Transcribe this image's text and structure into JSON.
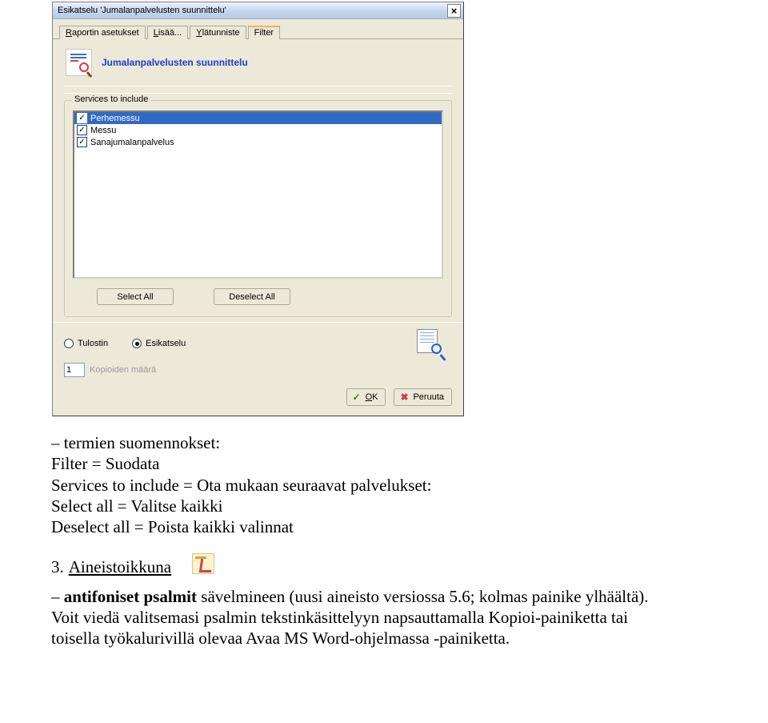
{
  "dialog": {
    "title": "Esikatselu 'Jumalanpalvelusten suunnittelu'",
    "tabs": {
      "report_settings": "Raportin asetukset",
      "add": "Lisää...",
      "header": "Ylätunniste",
      "filter": "Filter"
    },
    "content_header": "Jumalanpalvelusten suunnittelu",
    "group": {
      "legend": "Services to include",
      "items": [
        "Perhemessu",
        "Messu",
        "Sanajumalanpalvelus"
      ],
      "select_all": "Select All",
      "deselect_all": "Deselect All"
    },
    "output": {
      "printer": "Tulostin",
      "preview": "Esikatselu",
      "copies_value": "1",
      "copies_label": "Kopioiden määrä"
    },
    "actions": {
      "ok": "OK",
      "cancel": "Peruuta"
    }
  },
  "body": {
    "para1_line1": "  termien suomennokset:",
    "para1_line2": "Filter = Suodata",
    "para1_line3": "Services to include = Ota mukaan seuraavat palvelukset:",
    "para1_line4": "Select all = Valitse kaikki",
    "para1_line5": "Deselect all = Poista kaikki valinnat",
    "heading_num": "3.",
    "heading_title": "Aineistoikkuna",
    "para2_prefix": "– ",
    "para2_bold": "antifoniset psalmit",
    "para2_rest": " sävelmineen (uusi aineisto versiossa 5.6; kolmas painike ylhäältä). Voit viedä valitsemasi psalmin tekstinkäsittelyyn napsauttamalla Kopioi-painiketta tai toisella työkalurivillä olevaa Avaa MS Word-ohjelmassa -painiketta."
  }
}
